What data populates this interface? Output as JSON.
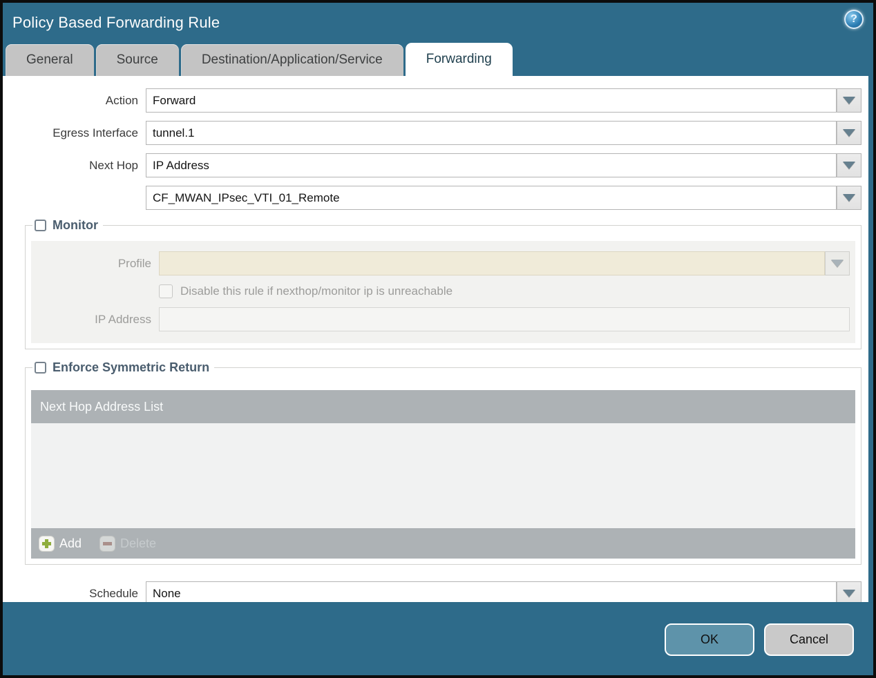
{
  "dialog": {
    "title": "Policy Based Forwarding Rule",
    "help_icon": "help-icon"
  },
  "tabs": [
    {
      "label": "General",
      "active": false
    },
    {
      "label": "Source",
      "active": false
    },
    {
      "label": "Destination/Application/Service",
      "active": false
    },
    {
      "label": "Forwarding",
      "active": true
    }
  ],
  "form": {
    "action": {
      "label": "Action",
      "value": "Forward"
    },
    "egress_interface": {
      "label": "Egress Interface",
      "value": "tunnel.1"
    },
    "next_hop": {
      "label": "Next Hop",
      "value": "IP Address"
    },
    "next_hop_address": {
      "value": "CF_MWAN_IPsec_VTI_01_Remote"
    },
    "schedule": {
      "label": "Schedule",
      "value": "None"
    }
  },
  "monitor": {
    "legend": "Monitor",
    "checked": false,
    "profile": {
      "label": "Profile",
      "value": "",
      "disabled": true
    },
    "disable_rule": {
      "label": "Disable this rule if nexthop/monitor ip is unreachable",
      "checked": false,
      "disabled": true
    },
    "ip_address": {
      "label": "IP Address",
      "value": "",
      "disabled": true
    }
  },
  "symmetric_return": {
    "legend": "Enforce Symmetric Return",
    "checked": false,
    "table": {
      "header": "Next Hop Address List",
      "rows": [],
      "add_label": "Add",
      "delete_label": "Delete",
      "delete_disabled": true
    }
  },
  "footer": {
    "ok_label": "OK",
    "cancel_label": "Cancel"
  },
  "icons": {
    "help": "?",
    "dropdown": "chevron-down",
    "add": "plus",
    "delete": "minus"
  },
  "colors": {
    "titlebar_teal": "#2e6b8a",
    "tab_inactive": "#c4c4c4",
    "tab_active_text": "#21414f",
    "legend_text": "#4a5d6e",
    "monitor_box": "#f2f2f0",
    "profile_cream": "#f0ebd9",
    "table_gray": "#adb2b5",
    "table_body": "#f1f2f2",
    "add_green": "#8fae3e",
    "delete_red": "#a8766a",
    "ok_button": "#5e93aa",
    "cancel_button": "#c9c9c9",
    "arrow_slate": "#66808f"
  }
}
